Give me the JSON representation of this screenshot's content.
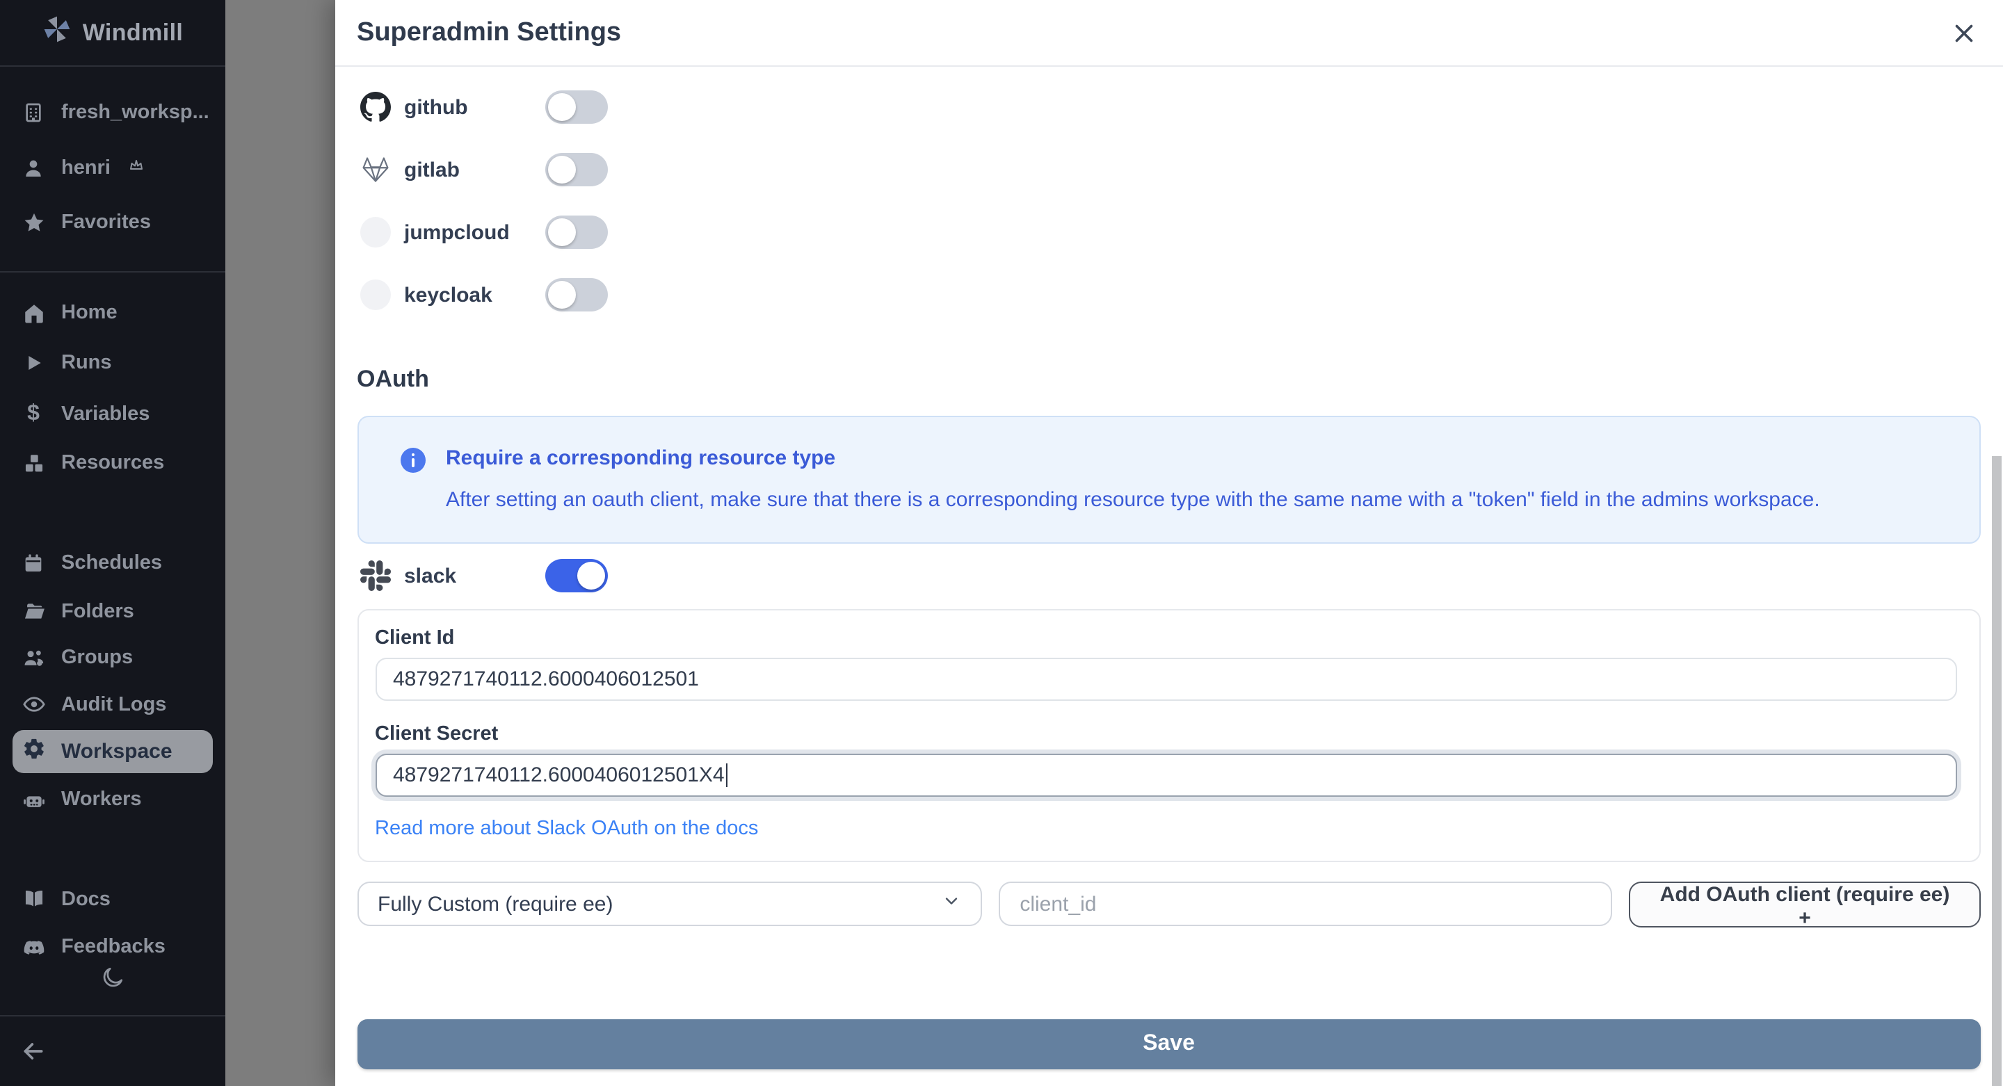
{
  "sidebar": {
    "app_name": "Windmill",
    "workspace_name": "fresh_worksp...",
    "user_name": "henri",
    "favorites": "Favorites",
    "nav_main": [
      {
        "label": "Home"
      },
      {
        "label": "Runs"
      },
      {
        "label": "Variables"
      },
      {
        "label": "Resources"
      }
    ],
    "nav_admin": [
      {
        "label": "Schedules"
      },
      {
        "label": "Folders"
      },
      {
        "label": "Groups"
      },
      {
        "label": "Audit Logs"
      },
      {
        "label": "Workspace",
        "active": true
      },
      {
        "label": "Workers"
      }
    ],
    "nav_footer": [
      {
        "label": "Docs"
      },
      {
        "label": "Feedbacks"
      }
    ]
  },
  "drawer": {
    "title": "Superadmin Settings",
    "providers": [
      {
        "name": "github",
        "enabled": false
      },
      {
        "name": "gitlab",
        "enabled": false
      },
      {
        "name": "jumpcloud",
        "enabled": false
      },
      {
        "name": "keycloak",
        "enabled": false
      }
    ],
    "oauth": {
      "heading": "OAuth",
      "info": {
        "title": "Require a corresponding resource type",
        "body": "After setting an oauth client, make sure that there is a corresponding resource type with the same name with a \"token\" field in the admins workspace."
      },
      "slack": {
        "name": "slack",
        "enabled": true,
        "client_id_label": "Client Id",
        "client_id_value": "4879271740112.6000406012501",
        "client_secret_label": "Client Secret",
        "client_secret_value": "4879271740112.6000406012501X4",
        "docs_link": "Read more about Slack OAuth on the docs"
      },
      "custom_client": {
        "type_selected": "Fully Custom (require ee)",
        "client_id_placeholder": "client_id",
        "add_button_label": "Add OAuth client (require ee) +"
      }
    },
    "save_label": "Save"
  },
  "colors": {
    "sidebar_bg": "#14161d",
    "toggle_on": "#3b63e8",
    "toggle_off": "#ccd1da",
    "info_text": "#3b5bd7",
    "link": "#3b82f6",
    "save_button": "#64809f"
  }
}
